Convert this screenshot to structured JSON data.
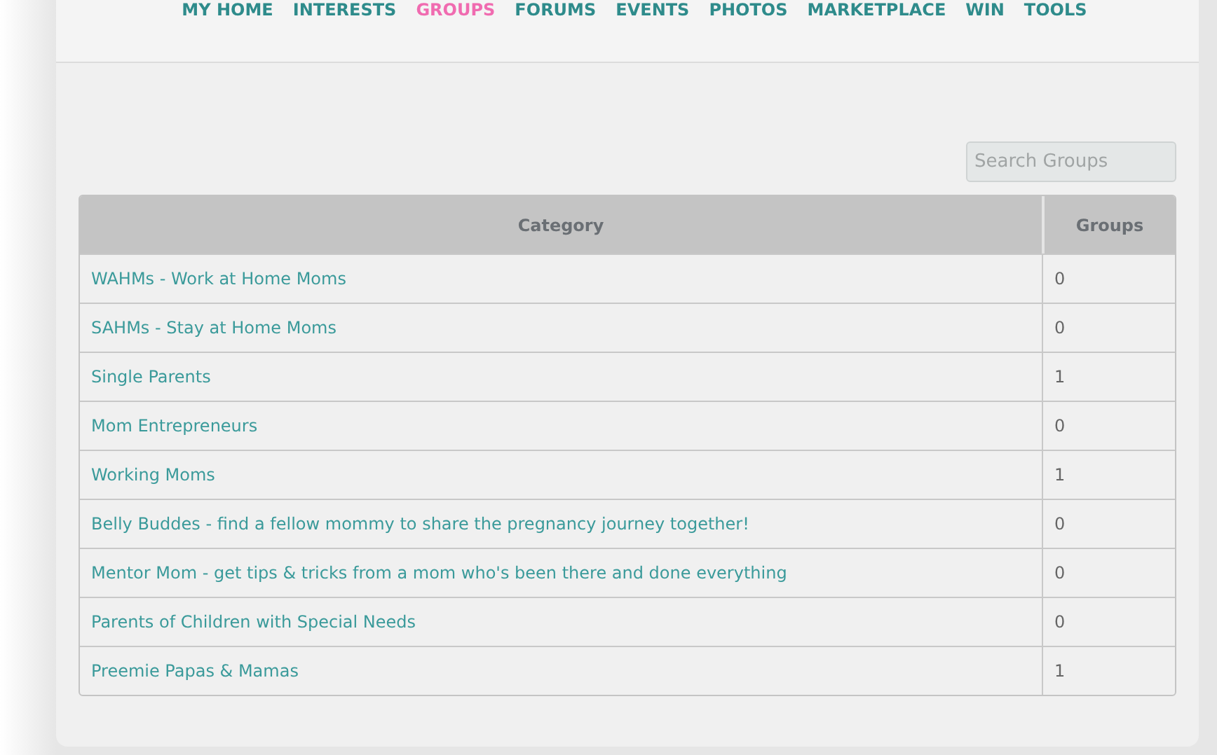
{
  "nav": [
    {
      "label": "MY HOME",
      "selected": false
    },
    {
      "label": "INTERESTS",
      "selected": false
    },
    {
      "label": "GROUPS",
      "selected": true
    },
    {
      "label": "FORUMS",
      "selected": false
    },
    {
      "label": "EVENTS",
      "selected": false
    },
    {
      "label": "PHOTOS",
      "selected": false
    },
    {
      "label": "MARKETPLACE",
      "selected": false
    },
    {
      "label": "WIN",
      "selected": false
    },
    {
      "label": "TOOLS",
      "selected": false
    }
  ],
  "search": {
    "placeholder": "Search Groups"
  },
  "table": {
    "columns": [
      "Category",
      "Groups"
    ],
    "rows": [
      [
        "WAHMs - Work at Home Moms",
        "0"
      ],
      [
        "SAHMs - Stay at Home Moms",
        "0"
      ],
      [
        "Single Parents",
        "1"
      ],
      [
        "Mom Entrepreneurs",
        "0"
      ],
      [
        "Working Moms",
        "1"
      ],
      [
        "Belly Buddes - find a fellow mommy to share the pregnancy journey together!",
        "0"
      ],
      [
        "Mentor Mom - get tips & tricks from a mom who's been there and done everything",
        "0"
      ],
      [
        "Parents of Children with Special Needs",
        "0"
      ],
      [
        "Preemie Papas & Mamas",
        "1"
      ]
    ]
  }
}
